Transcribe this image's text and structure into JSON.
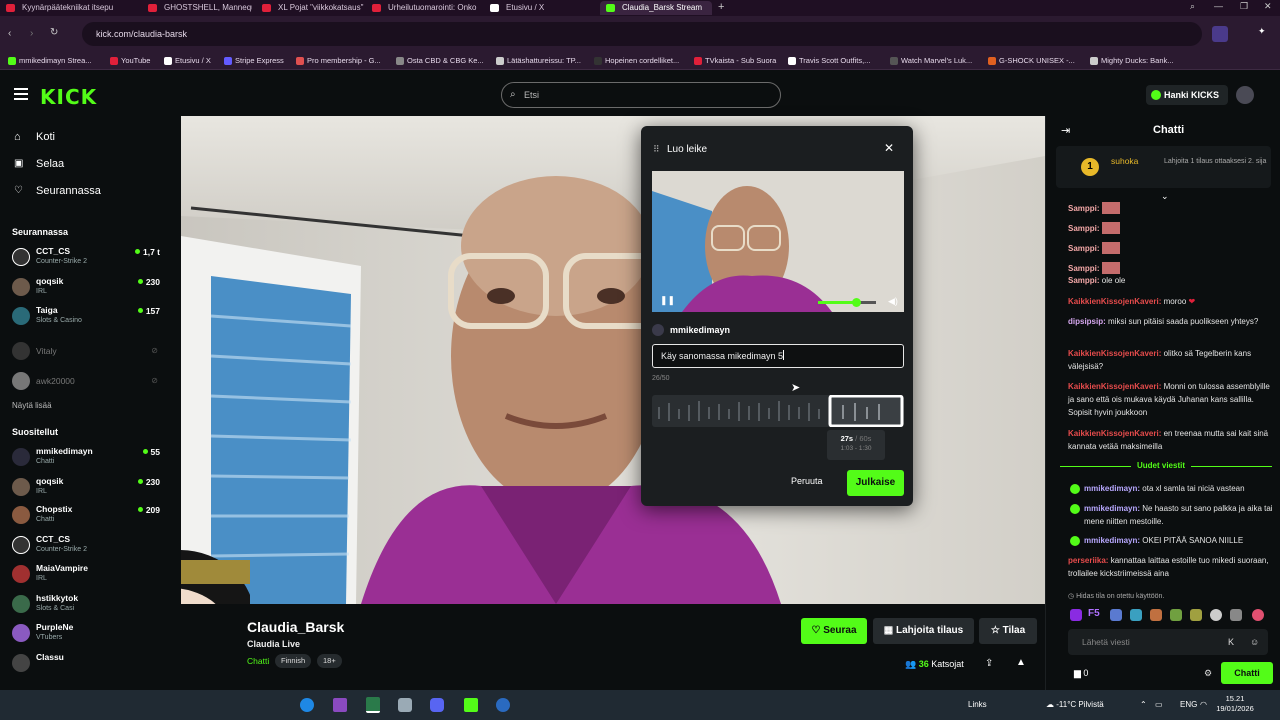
{
  "browser": {
    "tabs": [
      {
        "label": "Kyynärpäätekniikat itsepu",
        "color": "#e0203a"
      },
      {
        "label": "GHOSTSHELL, Mannequin",
        "color": "#e0203a"
      },
      {
        "label": "XL Pojat \"viikkokatsaus\"",
        "color": "#e0203a"
      },
      {
        "label": "Urheilutuomarointi: Onko",
        "color": "#e0203a"
      },
      {
        "label": "Etusivu / X",
        "color": "#ffffff"
      },
      {
        "label": "Claudia_Barsk Stream",
        "color": "#53fc18",
        "active": true
      }
    ],
    "url": "kick.com/claudia-barsk",
    "bookmarks": [
      {
        "label": "mmikedimayn Strea...",
        "color": "#53fc18"
      },
      {
        "label": "YouTube",
        "color": "#e0203a"
      },
      {
        "label": "Etusivu / X",
        "color": "#ffffff"
      },
      {
        "label": "Stripe Express",
        "color": "#635bff"
      },
      {
        "label": "Pro membership - G...",
        "color": "#e05050"
      },
      {
        "label": "Osta CBD & CBG Ke...",
        "color": "#888888"
      },
      {
        "label": "Lätäshattureissu: TP...",
        "color": "#cccccc"
      },
      {
        "label": "Hopeinen cordelliket...",
        "color": "#333333"
      },
      {
        "label": "TVkaista - Sub Suora",
        "color": "#e0203a"
      },
      {
        "label": "Travis Scott Outfits,...",
        "color": "#ffffff"
      },
      {
        "label": "Watch Marvel's Luk...",
        "color": "#555555"
      },
      {
        "label": "G-SHOCK UNISEX -...",
        "color": "#e06020"
      },
      {
        "label": "Mighty Ducks: Bank...",
        "color": "#cccccc"
      }
    ]
  },
  "kick": {
    "logo": "KICK",
    "search_placeholder": "Etsi",
    "get_kicks": "Hanki KICKS",
    "nav": [
      {
        "label": "Koti",
        "icon": "home-icon"
      },
      {
        "label": "Selaa",
        "icon": "browse-icon"
      },
      {
        "label": "Seurannassa",
        "icon": "heart-icon"
      }
    ],
    "following_title": "Seurannassa",
    "following": [
      {
        "name": "CCT_CS",
        "category": "Counter-Strike 2",
        "viewers": "1,7 t"
      },
      {
        "name": "qoqsik",
        "category": "IRL",
        "viewers": "230"
      },
      {
        "name": "Taiga",
        "category": "Slots & Casino",
        "viewers": "157"
      },
      {
        "name": "Vitaly",
        "category": "",
        "viewers": "",
        "offline": true
      },
      {
        "name": "awk20000",
        "category": "",
        "viewers": "",
        "offline": true
      }
    ],
    "show_more": "Näytä lisää",
    "recommended_title": "Suositellut",
    "recommended": [
      {
        "name": "mmikedimayn",
        "category": "Chatti",
        "viewers": "55"
      },
      {
        "name": "qoqsik",
        "category": "IRL",
        "viewers": "230"
      },
      {
        "name": "Chopstix",
        "category": "Chatti",
        "viewers": "209"
      },
      {
        "name": "CCT_CS",
        "category": "Counter-Strike 2",
        "viewers": ""
      },
      {
        "name": "MaiaVampire",
        "category": "IRL",
        "viewers": ""
      },
      {
        "name": "hstikkytok",
        "category": "Slots & Casi",
        "viewers": ""
      },
      {
        "name": "PurpleNe",
        "category": "VTubers",
        "viewers": ""
      },
      {
        "name": "Classu",
        "category": "",
        "viewers": ""
      }
    ]
  },
  "clip": {
    "title": "Luo leike",
    "author": "mmikedimayn",
    "text": "Käy sanomassa mikedimayn 5",
    "char_count": "26/50",
    "duration": "27s",
    "duration_max": "60s",
    "range": "1:03 - 1:30",
    "cancel": "Peruuta",
    "publish": "Julkaise",
    "volume": 0.65
  },
  "stream": {
    "channel": "Claudia_Barsk",
    "title": "Claudia Live",
    "category": "Chatti",
    "tags": [
      "Finnish",
      "18+"
    ],
    "follow": "Seuraa",
    "gift": "Lahjoita tilaus",
    "subscribe": "Tilaa",
    "viewers": "36",
    "viewers_label": "Katsojat"
  },
  "chat": {
    "title": "Chatti",
    "pinned_user": "suhoka",
    "pinned_rank": "1",
    "pinned_text": "Lahjoita 1 tilaus ottaaksesi 2. sija",
    "messages": [
      {
        "user": "Samppi:",
        "text": "",
        "color": "#f4a8a8"
      },
      {
        "user": "Samppi:",
        "text": "",
        "color": "#f4a8a8"
      },
      {
        "user": "Samppi:",
        "text": "",
        "color": "#f4a8a8"
      },
      {
        "user": "Samppi:",
        "text": "",
        "color": "#f4a8a8"
      },
      {
        "user": "Samppi:",
        "text": "ole ole",
        "color": "#f4a8a8"
      },
      {
        "user": "KaikkienKissojenKaveri:",
        "text": "moroo",
        "color": "#e74c4c"
      },
      {
        "user": "dipsipsip:",
        "text": "miksi sun pitäisi saada puolikseen yhteys?",
        "color": "#d7a8f0"
      },
      {
        "user": "KaikkienKissojenKaveri:",
        "text": "olitko sä Tegelberin kans välejsisä?",
        "color": "#e74c4c"
      },
      {
        "user": "KaikkienKissojenKaveri:",
        "text": "Monni on tulossa assemblyille ja sano että ois mukava käydä Juhanan kans sallilla. Sopisit hyvin joukkoon",
        "color": "#e74c4c"
      },
      {
        "user": "KaikkienKissojenKaveri:",
        "text": "en treenaa mutta sai kait sinä kannata vetää maksimeilla",
        "color": "#e74c4c"
      }
    ],
    "new_messages": "Uudet viestit",
    "new": [
      {
        "user": "mmikedimayn:",
        "text": "ota xl samla tai niciä vastean",
        "color": "#b8a8ff"
      },
      {
        "user": "mmikedimayn:",
        "text": "Ne haasto sut sano palkka ja aika tai mene niitten mestoille.",
        "color": "#b8a8ff"
      },
      {
        "user": "mmikedimayn:",
        "text": "OKEI PITÄÄ SANOA NIILLE",
        "color": "#b8a8ff"
      },
      {
        "user": "perseriika:",
        "text": "kannattaa laittaa estoille tuo mikedi suoraan, trollailee kickstriimeissä aina",
        "color": "#e74c4c"
      }
    ],
    "slow_mode": "Hidas tila on otettu käyttöön.",
    "input_placeholder": "Lähetä viesti",
    "balance": "0",
    "send": "Chatti"
  },
  "taskbar": {
    "links": "Links",
    "weather": "-11°C  Pilvistä",
    "lang": "ENG",
    "time": "15.21",
    "date": "19/01/2026"
  }
}
